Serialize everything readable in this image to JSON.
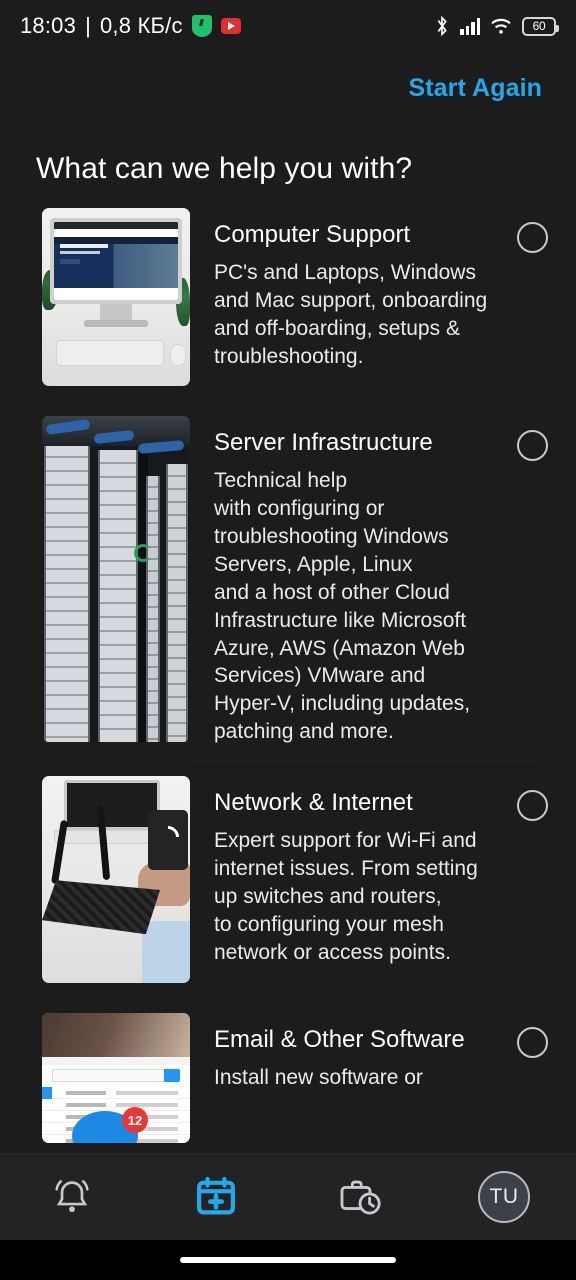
{
  "status_bar": {
    "time": "18:03",
    "separator": "|",
    "network_speed": "0,8 КБ/с",
    "left_icons": [
      "shield-icon",
      "youtube-icon"
    ],
    "right_icons": [
      "bluetooth-icon",
      "cellular-signal-icon",
      "wifi-icon"
    ],
    "battery_level": "60"
  },
  "topbar": {
    "start_again_label": "Start Again",
    "accent_color": "#21a9ec"
  },
  "page": {
    "title": "What can we help you with?"
  },
  "options": [
    {
      "title": "Computer Support",
      "description": "PC's and Laptops, Windows\nand Mac support, onboarding\nand off-boarding, setups &\ntroubleshooting.",
      "thumbnail": "imac-desktop-photo",
      "selected": false
    },
    {
      "title": "Server Infrastructure",
      "description": "Technical help\nwith configuring or\ntroubleshooting Windows\nServers, Apple, Linux\nand a host of other Cloud\nInfrastructure like Microsoft\nAzure, AWS (Amazon Web\nServices) VMware and\nHyper-V, including updates,\npatching and more.",
      "thumbnail": "server-racks-photo",
      "selected": false
    },
    {
      "title": "Network & Internet",
      "description": "Expert support for Wi-Fi and\ninternet issues. From setting\nup switches and routers,\nto configuring your mesh\nnetwork or access points.",
      "thumbnail": "wifi-router-photo",
      "selected": false
    },
    {
      "title": "Email & Other Software",
      "description": "Install new software or",
      "thumbnail": "email-inbox-photo",
      "selected": false
    }
  ],
  "bottom_nav": [
    {
      "icon": "bell-icon",
      "active": false
    },
    {
      "icon": "calendar-plus-icon",
      "active": true
    },
    {
      "icon": "briefcase-clock-icon",
      "active": false
    },
    {
      "icon": "avatar-icon",
      "initials": "TU",
      "active": false
    }
  ],
  "colors": {
    "background": "#1c1c1c",
    "accent": "#21a9ec",
    "nav_background": "#232323",
    "text_primary": "#ffffff",
    "text_secondary": "#eaeaea"
  }
}
